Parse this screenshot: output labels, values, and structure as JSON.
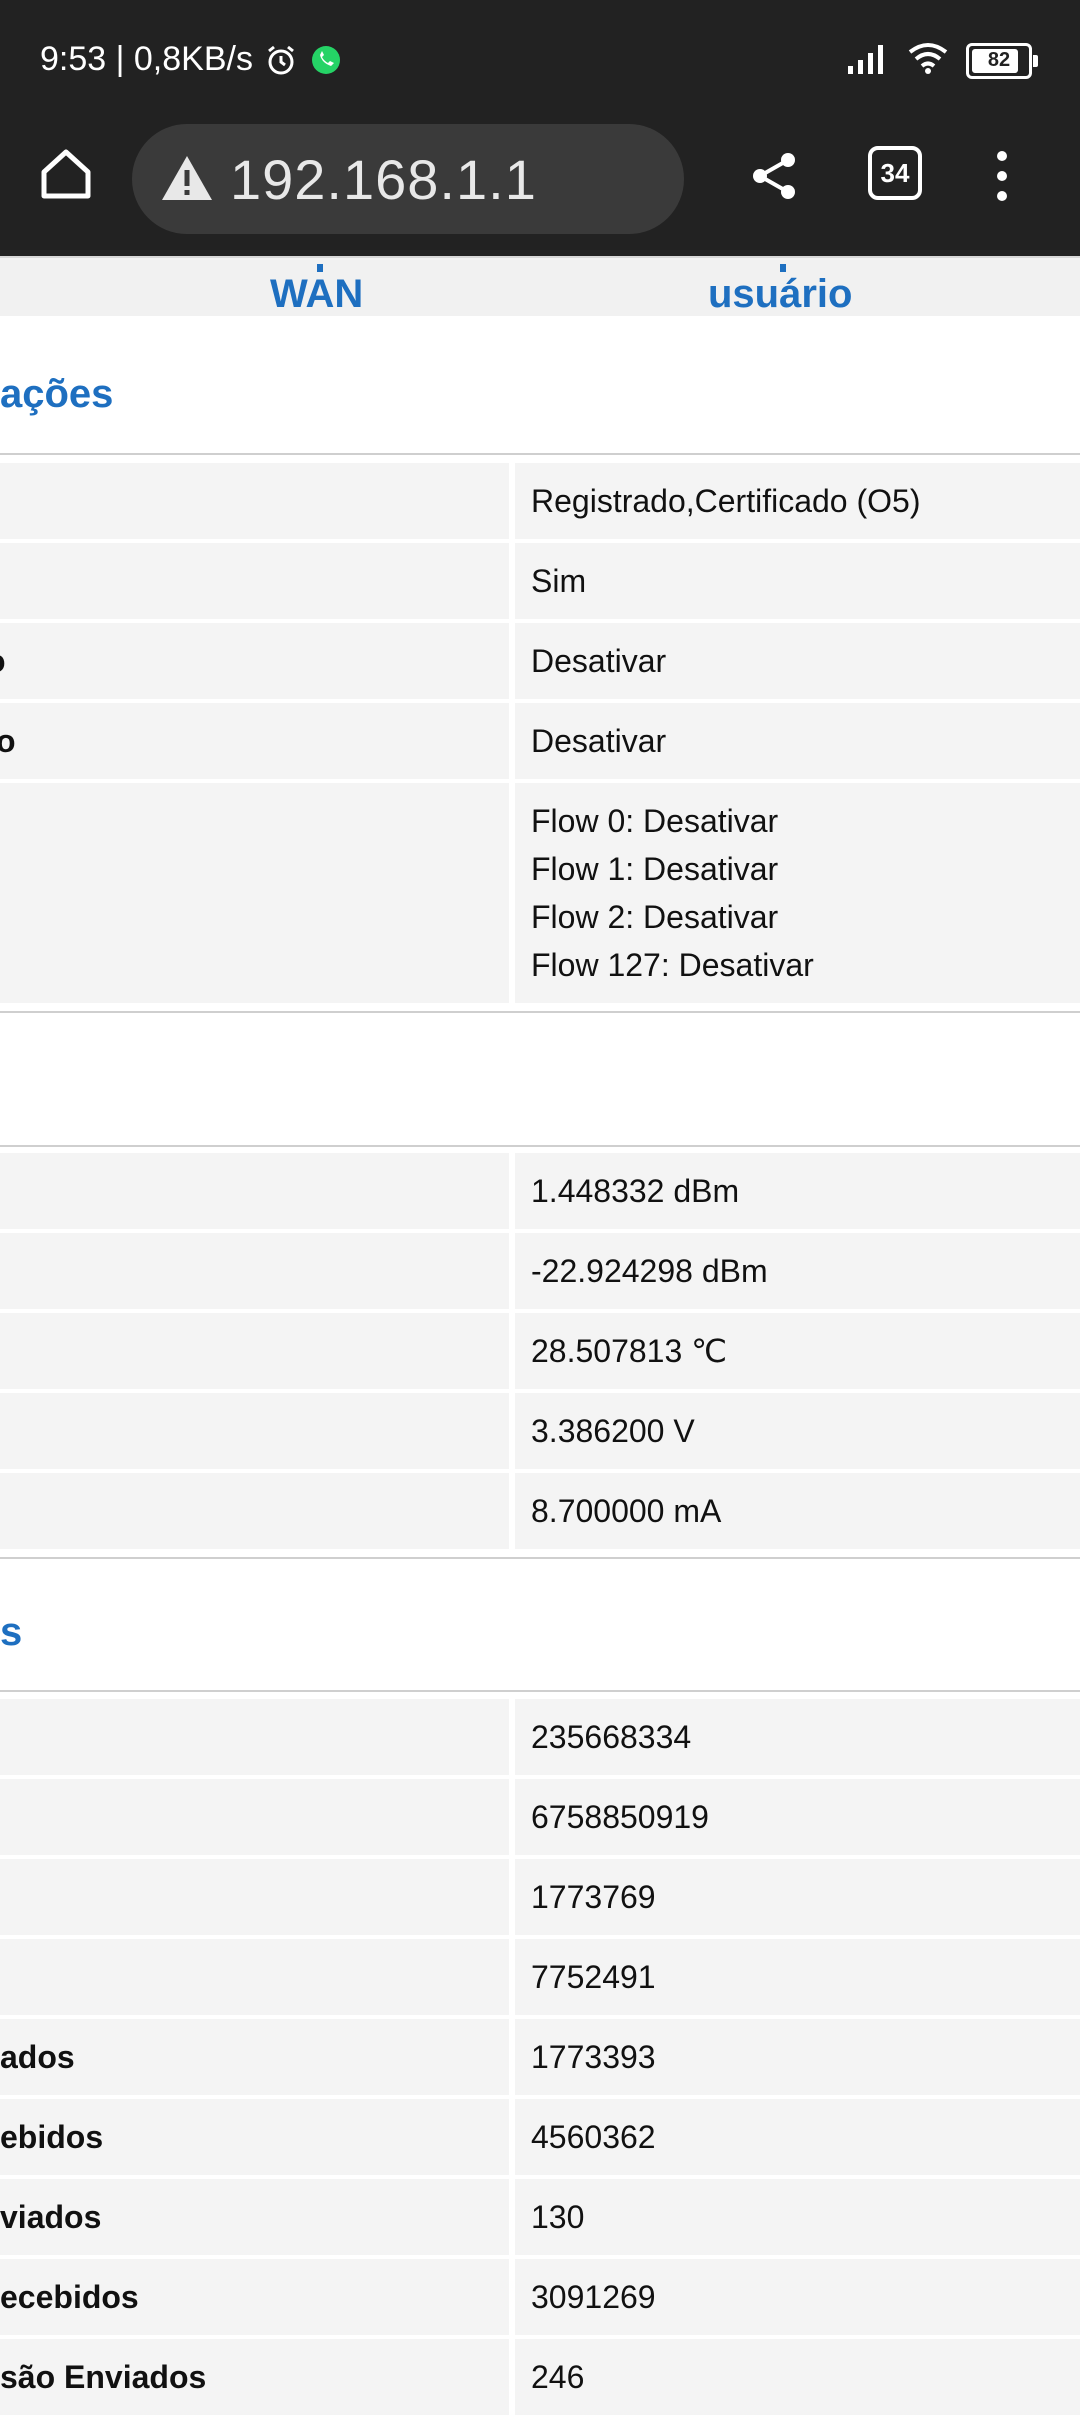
{
  "status_bar": {
    "time_and_speed": "9:53 | 0,8KB/s",
    "battery": "82"
  },
  "browser": {
    "url": "192.168.1.1",
    "tab_count": "34"
  },
  "nav_tabs": {
    "wan": "WAN",
    "usuario": "usuário"
  },
  "sections": {
    "s1_title": "ações",
    "s2_title": "",
    "s3_title": "s"
  },
  "section1": [
    {
      "label": "",
      "value": "Registrado,Certificado (O5)"
    },
    {
      "label": "",
      "value": "Sim"
    },
    {
      "label": "o",
      "value": "Desativar"
    },
    {
      "label": "o",
      "value": "Desativar"
    },
    {
      "label": "",
      "values": [
        "Flow 0: Desativar",
        "Flow 1: Desativar",
        "Flow 2: Desativar",
        "Flow 127: Desativar"
      ]
    }
  ],
  "section2": [
    {
      "label": "",
      "value": "1.448332 dBm"
    },
    {
      "label": "",
      "value": "-22.924298 dBm"
    },
    {
      "label": "",
      "value": "28.507813 ℃"
    },
    {
      "label": "",
      "value": "3.386200 V"
    },
    {
      "label": "",
      "value": "8.700000 mA"
    }
  ],
  "section3": [
    {
      "label": "",
      "value": "235668334"
    },
    {
      "label": "",
      "value": "6758850919"
    },
    {
      "label": "",
      "value": "1773769"
    },
    {
      "label": "",
      "value": "7752491"
    },
    {
      "label": "ados",
      "value": "1773393"
    },
    {
      "label": "ebidos",
      "value": "4560362"
    },
    {
      "label": "viados",
      "value": "130"
    },
    {
      "label": "ecebidos",
      "value": "3091269"
    },
    {
      "label": "são Enviados",
      "value": "246"
    }
  ],
  "colors": {
    "accent": "#1e6fc0",
    "topbar": "#222222",
    "cell": "#f4f4f4"
  }
}
